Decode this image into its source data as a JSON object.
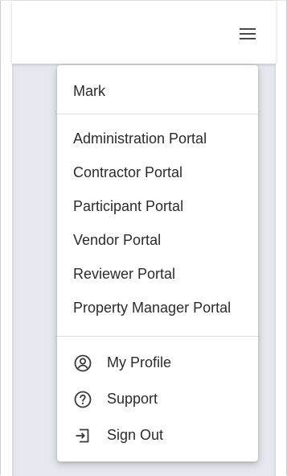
{
  "user": {
    "name": "Mark"
  },
  "portals": [
    {
      "label": "Administration Portal"
    },
    {
      "label": "Contractor Portal"
    },
    {
      "label": "Participant Portal"
    },
    {
      "label": "Vendor Portal"
    },
    {
      "label": "Reviewer Portal"
    },
    {
      "label": "Property Manager Portal"
    }
  ],
  "account_menu": [
    {
      "label": "My Profile",
      "icon": "account-circle-icon"
    },
    {
      "label": "Support",
      "icon": "help-circle-icon"
    },
    {
      "label": "Sign Out",
      "icon": "sign-out-icon"
    }
  ],
  "header": {
    "menu_icon": "hamburger-menu-icon"
  },
  "colors": {
    "text": "#2b2b2b",
    "page_background": "#e6e8ef",
    "surface": "#ffffff",
    "divider": "#dedfe3"
  }
}
